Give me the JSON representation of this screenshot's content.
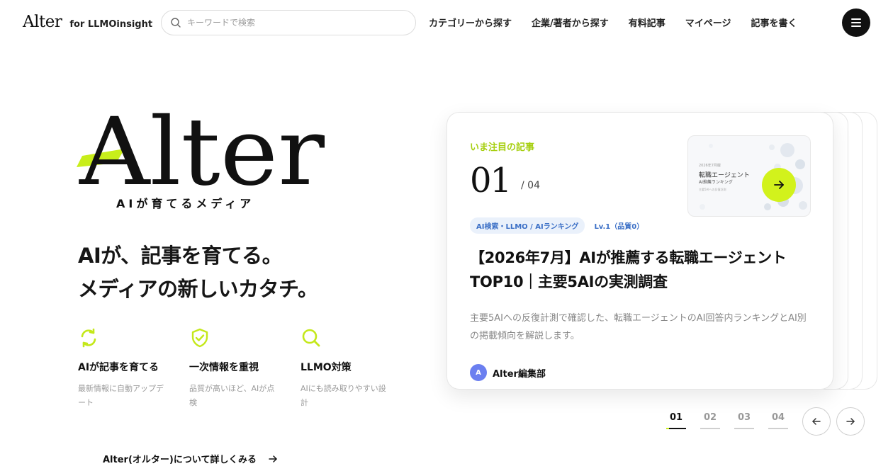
{
  "header": {
    "brand": "Alter",
    "brand_sub": "for LLMOinsight",
    "search_placeholder": "キーワードで検索",
    "nav": [
      "カテゴリーから探す",
      "企業/著者から探す",
      "有料記事",
      "マイページ",
      "記事を書く"
    ],
    "menu_icon": "hamburger-icon"
  },
  "hero": {
    "logo_text": "Alter",
    "tagline": "AIが育てるメディア",
    "headline": [
      "AIが、記事を育てる。",
      "メディアの新しいカタチ。"
    ],
    "features": [
      {
        "icon": "refresh-icon",
        "title": "AIが記事を育てる",
        "desc": "最新情報に自動アップデート"
      },
      {
        "icon": "shield-check-icon",
        "title": "一次情報を重視",
        "desc": "品質が高いほど、AIが点検"
      },
      {
        "icon": "search-icon",
        "title": "LLMO対策",
        "desc": "AIにも読み取りやすい設計"
      }
    ],
    "about_link": "Alter(オルター)について詳しくみる"
  },
  "featured": {
    "eyebrow": "いま注目の記事",
    "index": "01",
    "total": "/ 04",
    "thumbnail": {
      "line1": "2026年7月版",
      "line2": "転職エージェント",
      "line3": "AI推薦ランキング",
      "line4": "主要5AIへの反復計測"
    },
    "tag_category": "AI検索・LLMO / AIランキング",
    "tag_level": "Lv.1（品質0）",
    "title": "【2026年7月】AIが推薦する転職エージェントTOP10｜主要5AIの実測調査",
    "summary": "主要5AIへの反復計測で確認した、転職エージェントのAI回答内ランキングとAI別の掲載傾向を解説します。",
    "author_initial": "A",
    "author_name": "Alter編集部"
  },
  "pager": {
    "pages": [
      "01",
      "02",
      "03",
      "04"
    ],
    "active": 0
  },
  "colors": {
    "accent": "#c8ee1a",
    "accent_text": "#a6cf10",
    "tag_blue": "#3b6fc6",
    "avatar": "#6b7ff0"
  }
}
